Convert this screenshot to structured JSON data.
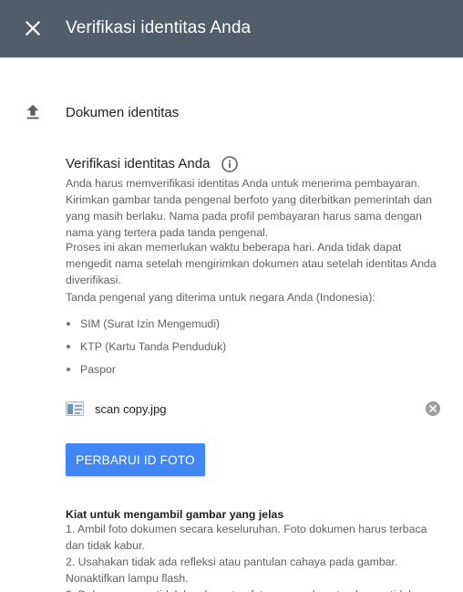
{
  "header": {
    "title": "Verifikasi identitas Anda",
    "background": "#4f5e6a"
  },
  "document_section": {
    "icon": "upload-icon",
    "label": "Dokumen identitas"
  },
  "verify_section": {
    "title": "Verifikasi identitas Anda",
    "info_icon": "info-icon",
    "paragraph1": "Anda harus memverifikasi identitas Anda untuk menerima pembayaran. Kirimkan gambar tanda pengenal berfoto yang diterbitkan pemerintah dan yang masih berlaku. Nama pada profil pembayaran harus sama dengan nama yang tertera pada tanda pengenal.",
    "paragraph2": "Proses ini akan memerlukan waktu beberapa hari. Anda tidak dapat mengedit nama setelah mengirimkan dokumen atau setelah identitas Anda diverifikasi.",
    "paragraph3": "Tanda pengenal yang diterima untuk negara Anda (Indonesia):",
    "accepted_ids": [
      "SIM (Surat Izin Mengemudi)",
      "KTP (Kartu Tanda Penduduk)",
      "Paspor"
    ]
  },
  "file": {
    "name": "scan copy.jpg",
    "remove_icon": "remove-circle-icon"
  },
  "update_button": {
    "label": "PERBARUI ID FOTO",
    "color": "#4285f4"
  },
  "tips": {
    "title": "Kiat untuk mengambil gambar yang jelas",
    "text": "1. Ambil foto dokumen secara keseluruhan. Foto dokumen harus terbaca dan tidak kabur.\n2. Usahakan tidak ada refleksi atau pantulan cahaya pada gambar. Nonaktifkan lampu flash.\n3. Dokumen yang tidak lengkap atau foto yang gelap atau buram tidak"
  }
}
